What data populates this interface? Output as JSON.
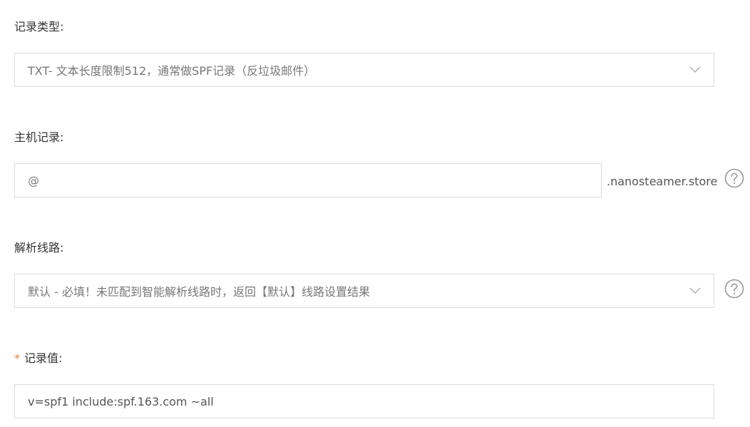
{
  "record_type": {
    "label": "记录类型:",
    "selected": "TXT- 文本长度限制512，通常做SPF记录（反垃圾邮件）"
  },
  "host_record": {
    "label": "主机记录:",
    "value": "@",
    "suffix": ".nanosteamer.store",
    "help_icon": "question-circle-icon"
  },
  "line": {
    "label": "解析线路:",
    "selected": "默认 - 必填！未匹配到智能解析线路时，返回【默认】线路设置结果",
    "help_icon": "question-circle-icon"
  },
  "record_value": {
    "required_mark": "*",
    "label": "记录值:",
    "value": "v=spf1 include:spf.163.com ~all"
  },
  "colors": {
    "border": "#dcdcdc",
    "text": "#333333",
    "placeholder_text": "#777777",
    "required": "#e0803a",
    "icon": "#999999"
  }
}
